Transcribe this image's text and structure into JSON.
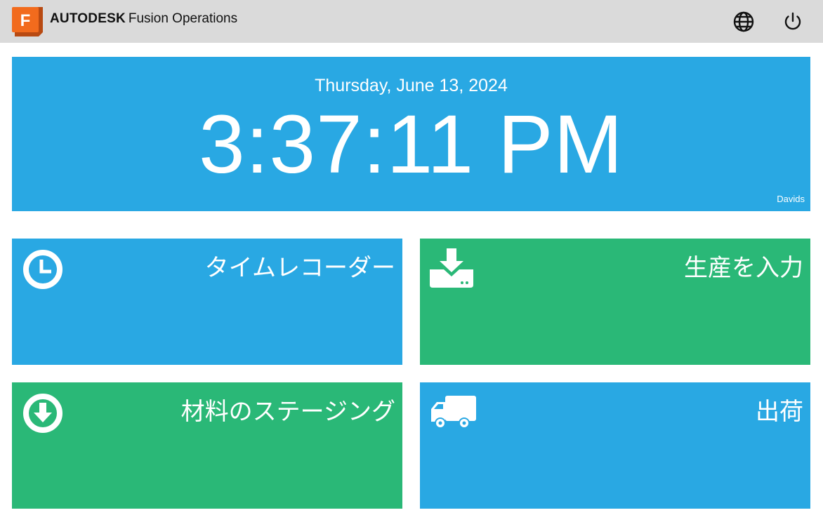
{
  "header": {
    "company": "AUTODESK",
    "product": "Fusion Operations",
    "logo_letter": "F",
    "icons": [
      "globe-icon",
      "power-icon"
    ]
  },
  "clock": {
    "date": "Thursday, June 13, 2024",
    "time": "3:37:11 PM",
    "user": "Davids"
  },
  "tiles": [
    {
      "label": "タイムレコーダー",
      "icon": "clock-icon",
      "color": "#29a8e3"
    },
    {
      "label": "生産を入力",
      "icon": "download-tray-icon",
      "color": "#2ab877"
    },
    {
      "label": "材料のステージング",
      "icon": "arrow-down-circle-icon",
      "color": "#2ab877"
    },
    {
      "label": "出荷",
      "icon": "truck-icon",
      "color": "#29a8e3"
    }
  ],
  "colors": {
    "header_bg": "#dadada",
    "tile_blue": "#29a8e3",
    "tile_green": "#2ab877",
    "logo_orange": "#f26b1d"
  }
}
